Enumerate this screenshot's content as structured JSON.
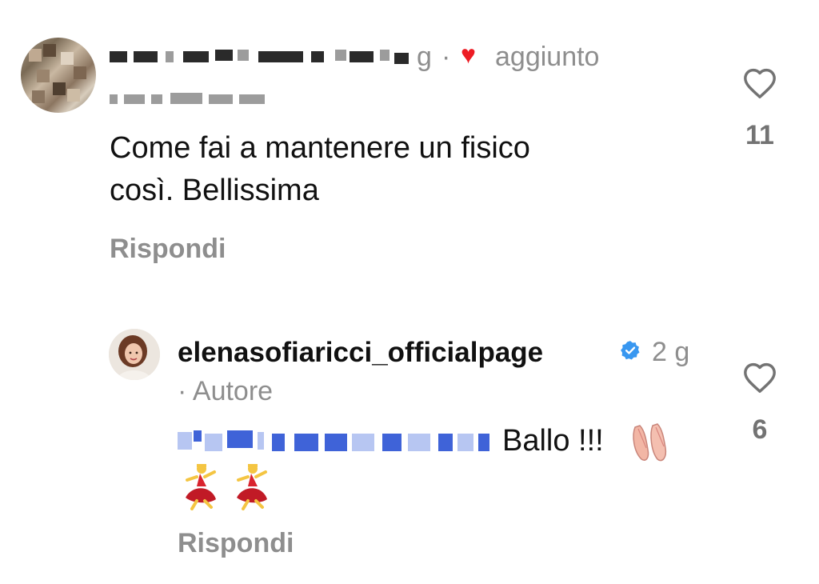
{
  "comment1": {
    "avatar": "pixelated-avatar",
    "username_visible": "g",
    "separator": "·",
    "liked_by_author_label": "aggiunto",
    "text_line1": "Come fai a mantenere un fisico",
    "text_line2": "così. Bellissima",
    "reply_label": "Rispondi",
    "like_count": "11",
    "heart_color": "#ed1c24"
  },
  "reply1": {
    "username": "elenasofiaricci_officialpage",
    "time": "2 g",
    "author_badge": "· Autore",
    "text": "Ballo !!!",
    "emoji_1": "ballet-shoes",
    "emoji_2": "dancer",
    "emoji_3": "dancer",
    "reply_label": "Rispondi",
    "like_count": "6",
    "verified_color": "#3897f0"
  }
}
